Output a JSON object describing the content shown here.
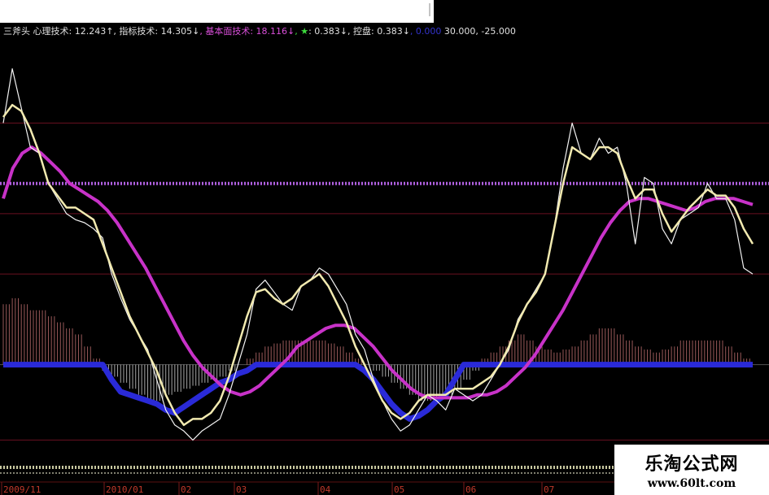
{
  "legend": [
    {
      "text": "三斧头 ",
      "color": "#e0e0e0"
    },
    {
      "text": "心理技术: 12.243↑",
      "color": "#e0e0e0"
    },
    {
      "text": ", 指标技术: 14.305↓",
      "color": "#e0e0e0"
    },
    {
      "text": ", 基本面技术: 18.116↓",
      "color": "#d94fd9"
    },
    {
      "text": ", ★",
      "color": "#3ddc3d"
    },
    {
      "text": ": 0.383↓",
      "color": "#e0e0e0"
    },
    {
      "text": ", 控盘: 0.383↓",
      "color": "#e0e0e0"
    },
    {
      "text": ", 0.000",
      "color": "#3333cc"
    },
    {
      "text": " 30.000",
      "color": "#e0e0e0"
    },
    {
      "text": ", -25.000",
      "color": "#e0e0e0"
    }
  ],
  "watermark": {
    "title": "乐淘公式网",
    "url": "www.60lt.com"
  },
  "colors": {
    "white_line": "#f2f2f2",
    "yellow_line": "#f2eab0",
    "magenta_line": "#c832c8",
    "blue_band": "#2a2ad8",
    "dotted_purple": "#b060e0",
    "dark_red_grid": "#6a1020",
    "hist_pos": "#c07070",
    "hist_neg": "#d0d0d0"
  },
  "chart_data": {
    "type": "line",
    "x_labels": [
      "2009/11",
      "2010/01",
      "02",
      "03",
      "04",
      "05",
      "06",
      "07"
    ],
    "ylim": [
      -30,
      110
    ],
    "reference_levels": [
      80,
      60,
      50,
      30,
      0,
      -25
    ],
    "series": [
      {
        "key": "white",
        "values": [
          80,
          98,
          85,
          72,
          70,
          60,
          55,
          50,
          48,
          47,
          45,
          42,
          30,
          22,
          15,
          10,
          5,
          -5,
          -15,
          -20,
          -22,
          -25,
          -22,
          -20,
          -18,
          -10,
          0,
          10,
          25,
          28,
          24,
          20,
          18,
          26,
          28,
          32,
          30,
          25,
          20,
          10,
          5,
          -5,
          -12,
          -18,
          -22,
          -20,
          -15,
          -10,
          -12,
          -15,
          -8,
          -10,
          -12,
          -10,
          -5,
          0,
          5,
          15,
          20,
          25,
          30,
          45,
          65,
          80,
          70,
          68,
          75,
          70,
          72,
          60,
          40,
          62,
          60,
          45,
          40,
          48,
          50,
          52,
          60,
          55,
          55,
          48,
          32,
          30
        ]
      },
      {
        "key": "yellow",
        "values": [
          82,
          86,
          84,
          78,
          70,
          60,
          56,
          52,
          52,
          50,
          48,
          40,
          32,
          24,
          16,
          10,
          4,
          -2,
          -10,
          -16,
          -20,
          -18,
          -18,
          -16,
          -12,
          -4,
          6,
          16,
          24,
          25,
          22,
          20,
          22,
          26,
          28,
          30,
          26,
          20,
          14,
          6,
          0,
          -6,
          -12,
          -16,
          -18,
          -16,
          -12,
          -10,
          -10,
          -10,
          -8,
          -8,
          -8,
          -6,
          -4,
          0,
          6,
          14,
          20,
          24,
          30,
          45,
          60,
          72,
          70,
          68,
          72,
          72,
          70,
          62,
          55,
          58,
          58,
          50,
          44,
          48,
          52,
          55,
          58,
          56,
          56,
          52,
          45,
          40
        ]
      },
      {
        "key": "magenta",
        "values": [
          55,
          65,
          70,
          72,
          70,
          67,
          64,
          60,
          58,
          56,
          54,
          51,
          47,
          42,
          37,
          32,
          26,
          20,
          14,
          8,
          3,
          -1,
          -4,
          -7,
          -9,
          -10,
          -9,
          -7,
          -4,
          -1,
          2,
          6,
          8,
          10,
          12,
          13,
          13,
          12,
          9,
          6,
          2,
          -2,
          -5,
          -8,
          -10,
          -11,
          -11,
          -11,
          -11,
          -11,
          -10,
          -10,
          -9,
          -7,
          -4,
          -1,
          3,
          8,
          13,
          18,
          24,
          30,
          36,
          42,
          47,
          51,
          54,
          55,
          55,
          54,
          53,
          52,
          51,
          52,
          54,
          55,
          55,
          55,
          54,
          53
        ]
      },
      {
        "key": "blue_band",
        "values": [
          0,
          0,
          0,
          0,
          0,
          0,
          0,
          0,
          0,
          0,
          0,
          0,
          -5,
          -9,
          -10,
          -11,
          -12,
          -13,
          -15,
          -16,
          -14,
          -12,
          -10,
          -8,
          -6,
          -5,
          -3,
          -2,
          0,
          0,
          0,
          0,
          0,
          0,
          0,
          0,
          0,
          0,
          0,
          0,
          -2,
          -5,
          -9,
          -13,
          -16,
          -18,
          -17,
          -15,
          -12,
          -10,
          -5,
          0,
          0,
          0,
          0,
          0,
          0,
          0,
          0,
          0,
          0,
          0,
          0,
          0,
          0,
          0,
          0,
          0,
          0,
          0,
          0,
          0,
          0,
          0,
          0,
          0,
          0,
          0,
          0,
          0,
          0,
          0,
          0,
          0
        ]
      },
      {
        "key": "histogram",
        "values": [
          20,
          22,
          20,
          18,
          18,
          16,
          14,
          12,
          10,
          6,
          2,
          -2,
          -4,
          -6,
          -8,
          -10,
          -12,
          -12,
          -10,
          -9,
          -8,
          -7,
          -6,
          -5,
          -4,
          -2,
          0,
          2,
          4,
          6,
          7,
          8,
          8,
          8,
          8,
          8,
          7,
          6,
          4,
          2,
          0,
          -2,
          -4,
          -6,
          -8,
          -10,
          -12,
          -12,
          -11,
          -10,
          -8,
          -5,
          -2,
          2,
          4,
          6,
          8,
          10,
          8,
          6,
          5,
          4,
          5,
          6,
          8,
          10,
          12,
          12,
          10,
          8,
          6,
          5,
          4,
          5,
          6,
          8,
          8,
          8,
          8,
          8,
          6,
          4,
          2,
          0
        ]
      }
    ]
  }
}
